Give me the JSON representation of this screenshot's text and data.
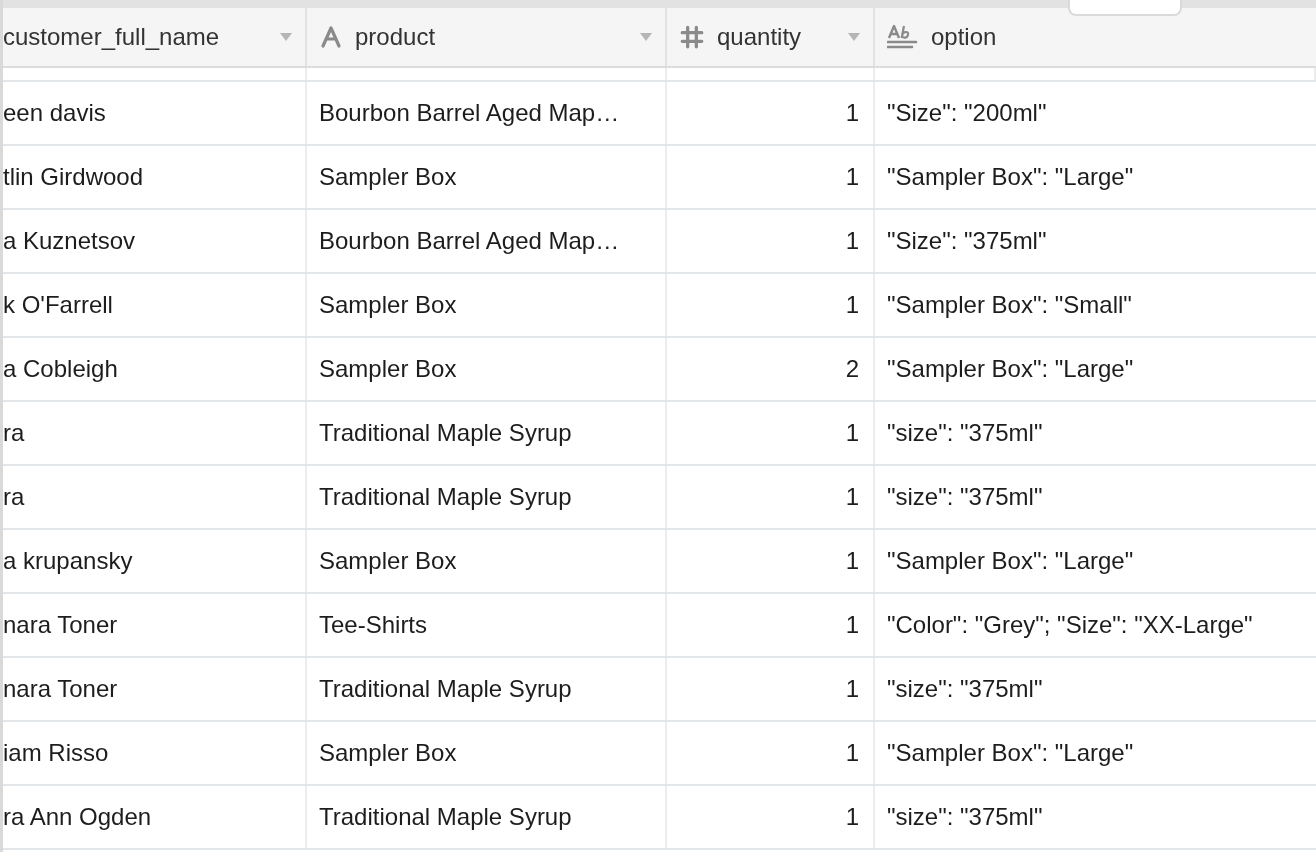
{
  "table": {
    "columns": [
      {
        "label": "customer_full_name",
        "kind": "none",
        "menu": true
      },
      {
        "label": "product",
        "kind": "text",
        "menu": true
      },
      {
        "label": "quantity",
        "kind": "number",
        "menu": true
      },
      {
        "label": "option",
        "kind": "longtext",
        "menu": false
      }
    ],
    "rows": [
      [
        "een davis",
        "Bourbon Barrel Aged Map…",
        "1",
        "\"Size\": \"200ml\""
      ],
      [
        "tlin Girdwood",
        "Sampler Box",
        "1",
        "\"Sampler Box\": \"Large\""
      ],
      [
        "a Kuznetsov",
        "Bourbon Barrel Aged Map…",
        "1",
        "\"Size\": \"375ml\""
      ],
      [
        "k O'Farrell",
        "Sampler Box",
        "1",
        "\"Sampler Box\": \"Small\""
      ],
      [
        "a Cobleigh",
        "Sampler Box",
        "2",
        "\"Sampler Box\": \"Large\""
      ],
      [
        "ra",
        "Traditional Maple Syrup",
        "1",
        "\"size\": \"375ml\""
      ],
      [
        "ra",
        "Traditional Maple Syrup",
        "1",
        "\"size\": \"375ml\""
      ],
      [
        "a krupansky",
        "Sampler Box",
        "1",
        "\"Sampler Box\": \"Large\""
      ],
      [
        "nara Toner",
        "Tee-Shirts",
        "1",
        "\"Color\": \"Grey\"; \"Size\": \"XX-Large\""
      ],
      [
        "nara Toner",
        "Traditional Maple Syrup",
        "1",
        "\"size\": \"375ml\""
      ],
      [
        "iam Risso",
        "Sampler Box",
        "1",
        "\"Sampler Box\": \"Large\""
      ],
      [
        "ra Ann Ogden",
        "Traditional Maple Syrup",
        "1",
        "\"size\": \"375ml\""
      ]
    ]
  }
}
